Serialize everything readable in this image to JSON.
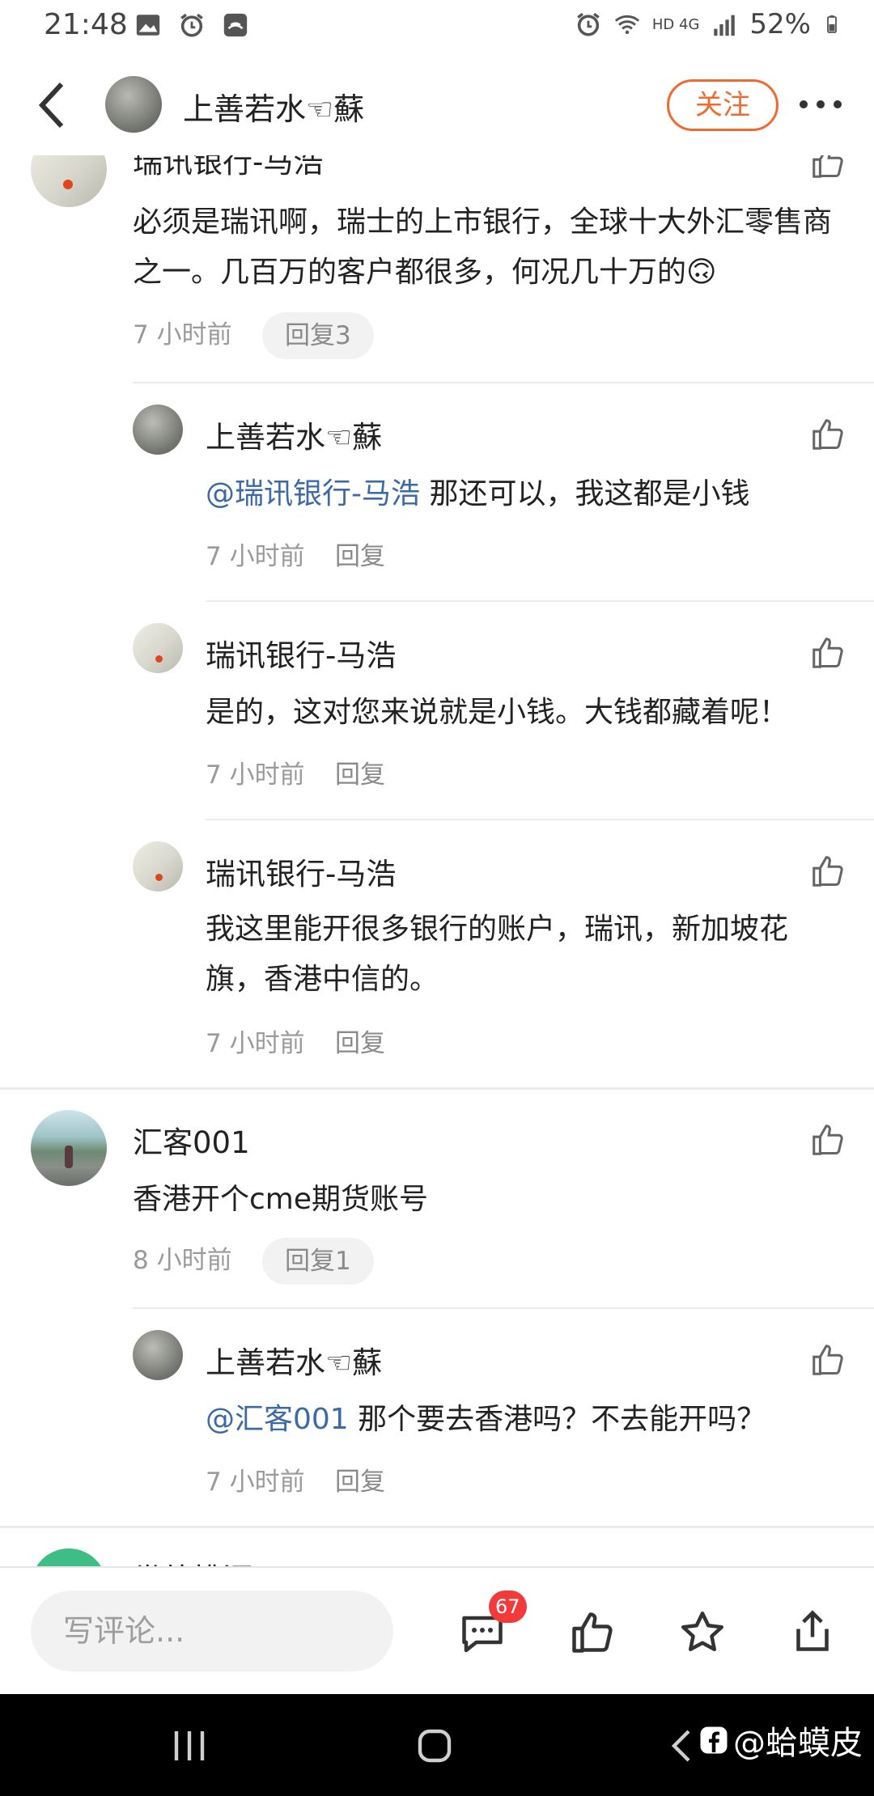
{
  "status_bar": {
    "time": "21:48",
    "battery": "52%",
    "network": "HD 4G"
  },
  "header": {
    "user_name": "上善若水☜蘇",
    "follow_label": "关注"
  },
  "comments": [
    {
      "name": "瑞讯银行-马浩",
      "text": "必须是瑞讯啊，瑞士的上市银行，全球十大外汇零售商之一。几百万的客户都很多，何况几十万的🙃",
      "time": "7 小时前",
      "reply": "回复3",
      "replies": [
        {
          "name": "上善若水☜蘇",
          "mention": "@瑞讯银行-马浩",
          "text": " 那还可以，我这都是小钱",
          "time": "7 小时前",
          "reply": "回复"
        },
        {
          "name": "瑞讯银行-马浩",
          "text": "是的，这对您来说就是小钱。大钱都藏着呢！",
          "time": "7 小时前",
          "reply": "回复"
        },
        {
          "name": "瑞讯银行-马浩",
          "text": "我这里能开很多银行的账户，瑞讯，新加坡花旗，香港中信的。",
          "time": "7 小时前",
          "reply": "回复"
        }
      ]
    },
    {
      "name": "汇客001",
      "text": "香港开个cme期货账号",
      "time": "8 小时前",
      "reply": "回复1",
      "replies": [
        {
          "name": "上善若水☜蘇",
          "mention": "@汇客001",
          "text": " 那个要去香港吗？不去能开吗？",
          "time": "7 小时前",
          "reply": "回复"
        }
      ]
    },
    {
      "name": "世外桃源"
    }
  ],
  "bottom_bar": {
    "input_placeholder": "写评论...",
    "comment_count": "67"
  },
  "watermark": "@蛤蟆皮",
  "colors": {
    "accent": "#f06a2f",
    "mention": "#3b6aa6",
    "badge": "#f23a3a"
  }
}
